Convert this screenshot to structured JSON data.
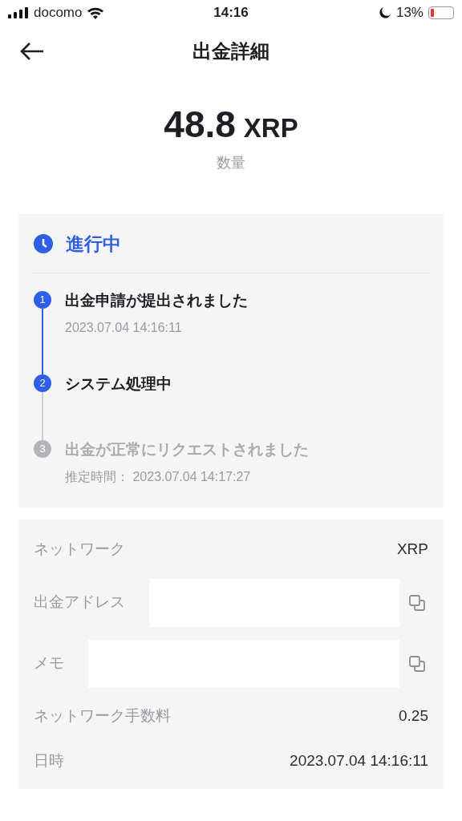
{
  "status_bar": {
    "carrier": "docomo",
    "time": "14:16",
    "battery": "13%"
  },
  "header": {
    "title": "出金詳細"
  },
  "amount": {
    "value": "48.8",
    "unit": "XRP",
    "label": "数量"
  },
  "progress": {
    "status": "進行中",
    "steps": [
      {
        "number": "1",
        "title": "出金申請が提出されました",
        "time": "2023.07.04 14:16:11",
        "active": true
      },
      {
        "number": "2",
        "title": "システム処理中",
        "active": true
      },
      {
        "number": "3",
        "title": "出金が正常にリクエストされました",
        "time": "推定時間： 2023.07.04 14:17:27",
        "active": false
      }
    ]
  },
  "details": [
    {
      "label": "ネットワーク",
      "value": "XRP",
      "redacted": false,
      "copyable": false
    },
    {
      "label": "出金アドレス",
      "redacted": true,
      "copyable": true
    },
    {
      "label": "メモ",
      "redacted": true,
      "copyable": true
    },
    {
      "label": "ネットワーク手数料",
      "value": "0.25",
      "redacted": false,
      "copyable": false
    },
    {
      "label": "日時",
      "value": "2023.07.04 14:16:11",
      "redacted": false,
      "copyable": false
    }
  ]
}
